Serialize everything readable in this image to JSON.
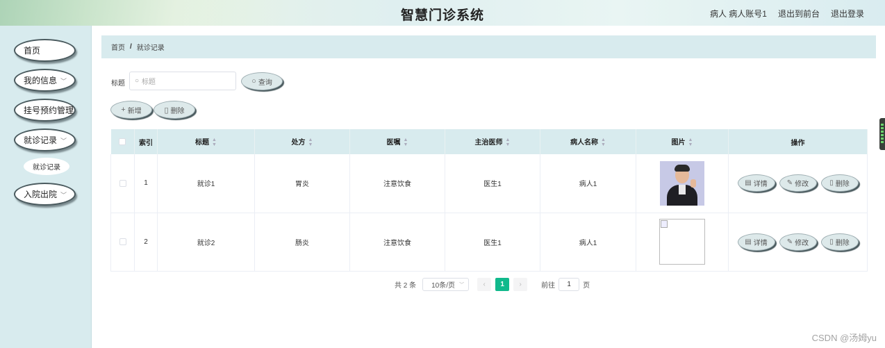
{
  "header": {
    "title": "智慧门诊系统",
    "user": "病人 病人账号1",
    "back_to_front": "退出到前台",
    "logout": "退出登录"
  },
  "sidebar": {
    "items": [
      {
        "label": "首页"
      },
      {
        "label": "我的信息"
      },
      {
        "label": "挂号预约管理"
      },
      {
        "label": "就诊记录"
      },
      {
        "label": "入院出院"
      }
    ],
    "sub_items": [
      {
        "label": "就诊记录"
      }
    ]
  },
  "breadcrumb": {
    "home": "首页",
    "separator": "/",
    "current": "就诊记录"
  },
  "search": {
    "label": "标题",
    "placeholder": "标题",
    "button": "查询"
  },
  "toolbar": {
    "add": "新增",
    "delete": "删除"
  },
  "table": {
    "columns": [
      "索引",
      "标题",
      "处方",
      "医嘱",
      "主治医师",
      "病人名称",
      "图片",
      "操作"
    ],
    "rows": [
      {
        "index": "1",
        "title": "就诊1",
        "prescription": "胃炎",
        "advice": "注意饮食",
        "doctor": "医生1",
        "patient": "病人1",
        "image": "photo"
      },
      {
        "index": "2",
        "title": "就诊2",
        "prescription": "肠炎",
        "advice": "注意饮食",
        "doctor": "医生1",
        "patient": "病人1",
        "image": "broken"
      }
    ],
    "actions": {
      "detail": "详情",
      "edit": "修改",
      "delete": "删除"
    }
  },
  "pagination": {
    "total": "共 2 条",
    "page_size": "10条/页",
    "prev": "‹",
    "current_page": "1",
    "next": "›",
    "goto_label": "前往",
    "goto_value": "1",
    "goto_suffix": "页"
  },
  "watermark": "CSDN @汤姆yu",
  "colors": {
    "accent": "#11b98c",
    "panel": "#d8ebee"
  }
}
